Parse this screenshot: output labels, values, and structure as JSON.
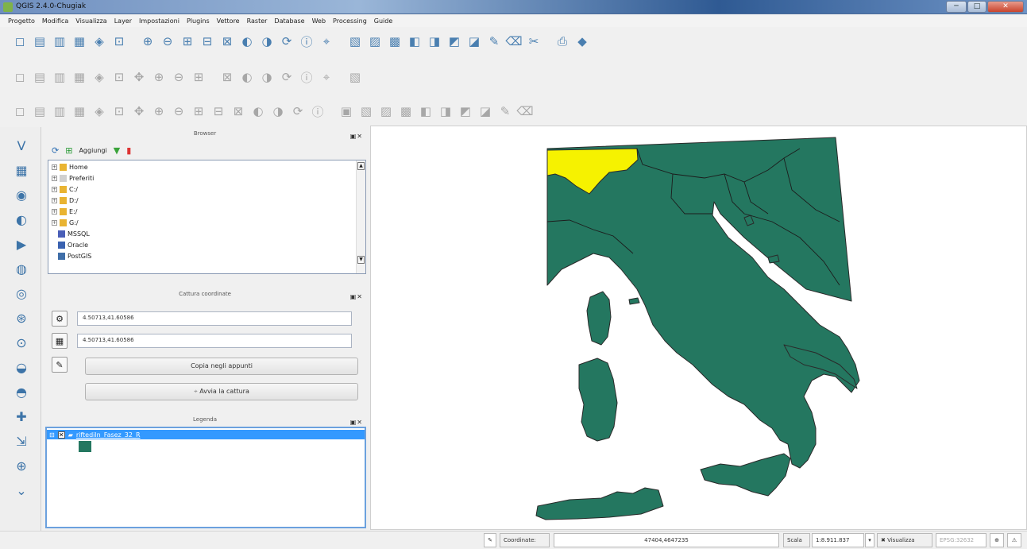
{
  "window": {
    "title": "QGIS 2.4.0-Chugiak",
    "minimize": "─",
    "maximize": "□",
    "close": "✕"
  },
  "menu": [
    "Progetto",
    "Modifica",
    "Visualizza",
    "Layer",
    "Impostazioni",
    "Plugins",
    "Vettore",
    "Raster",
    "Database",
    "Web",
    "Processing",
    "Guide"
  ],
  "toolbar_row1": [
    "new-project-icon",
    "open-project-icon",
    "save-project-icon",
    "save-as-icon",
    "print-composer-icon",
    "composer-manager-icon",
    "sep",
    "pan-icon",
    "pan-to-selection-icon",
    "zoom-in-icon",
    "zoom-out-icon",
    "zoom-full-icon",
    "zoom-layer-icon",
    "zoom-selection-icon",
    "zoom-last-icon",
    "zoom-next-icon",
    "refresh-icon",
    "sep",
    "identify-icon",
    "measure-icon",
    "select-icon",
    "attribute-table-icon",
    "field-calc-icon",
    "table-icon",
    "layout-icon",
    "annotation-icon",
    "map-tips-icon",
    "bookmark-icon",
    "sep",
    "help-icon",
    "whats-this-icon"
  ],
  "toolbar_row2": [
    "current-edits-icon",
    "toggle-edit-icon",
    "save-edits-icon",
    "add-feature-icon",
    "move-feature-icon",
    "node-tool-icon",
    "delete-selected-icon",
    "cut-icon",
    "copy-icon",
    "paste-icon",
    "sep",
    "label-icon",
    "label-pin-icon",
    "label-show-icon",
    "label-move-icon",
    "label-rotate-icon",
    "label-change-icon",
    "sep",
    "tile-scale-icon"
  ],
  "toolbar_row3": [
    "undo-icon",
    "redo-icon",
    "simplify-icon",
    "add-ring-icon",
    "add-part-icon",
    "fill-ring-icon",
    "delete-ring-icon",
    "delete-part-icon",
    "reshape-icon",
    "offset-curve-icon",
    "split-icon",
    "split-parts-icon",
    "merge-icon",
    "merge-attr-icon",
    "rotate-symbol-icon",
    "rotate-point-icon",
    "sep",
    "raster-a-icon",
    "raster-b-icon",
    "raster-c-icon",
    "raster-d-icon",
    "raster-e-icon",
    "raster-f-icon",
    "raster-g-icon",
    "raster-h-icon",
    "raster-i-icon",
    "raster-j-icon"
  ],
  "left_tools": [
    "add-vector-icon",
    "add-raster-icon",
    "add-postgis-icon",
    "add-spatialite-icon",
    "add-mssql-icon",
    "add-oracle-icon",
    "add-wms-icon",
    "add-wcs-icon",
    "add-wfs-icon",
    "add-delimited-icon",
    "add-gpx-icon",
    "new-layer-icon",
    "expand-icon",
    "capture-icon",
    "more-icon"
  ],
  "browser": {
    "title": "Browser",
    "add_label": "Aggiungi",
    "items": [
      "Home",
      "Preferiti",
      "C:/",
      "D:/",
      "E:/",
      "G:/",
      "MSSQL",
      "Oracle",
      "PostGIS"
    ]
  },
  "coord_capture": {
    "title": "Cattura coordinate",
    "value1": "4.50713,41.60586",
    "value2": "4.50713,41.60586",
    "copy_label": "Copia negli appunti",
    "start_label": "Avvia la cattura"
  },
  "legend": {
    "title": "Legenda",
    "layer_name": "riftediln_Fasez_32_R",
    "fill_color": "#247760"
  },
  "map": {
    "land_color": "#247760",
    "highlight_color": "#f6f200",
    "border_color": "#2a2a2a"
  },
  "status": {
    "coord_label": "Coordinate:",
    "coord_value": "47404,4647235",
    "scale_label": "Scala",
    "scale_value": "1:8.911.837",
    "render_label": "Visualizza",
    "crs": "EPSG:32632"
  }
}
